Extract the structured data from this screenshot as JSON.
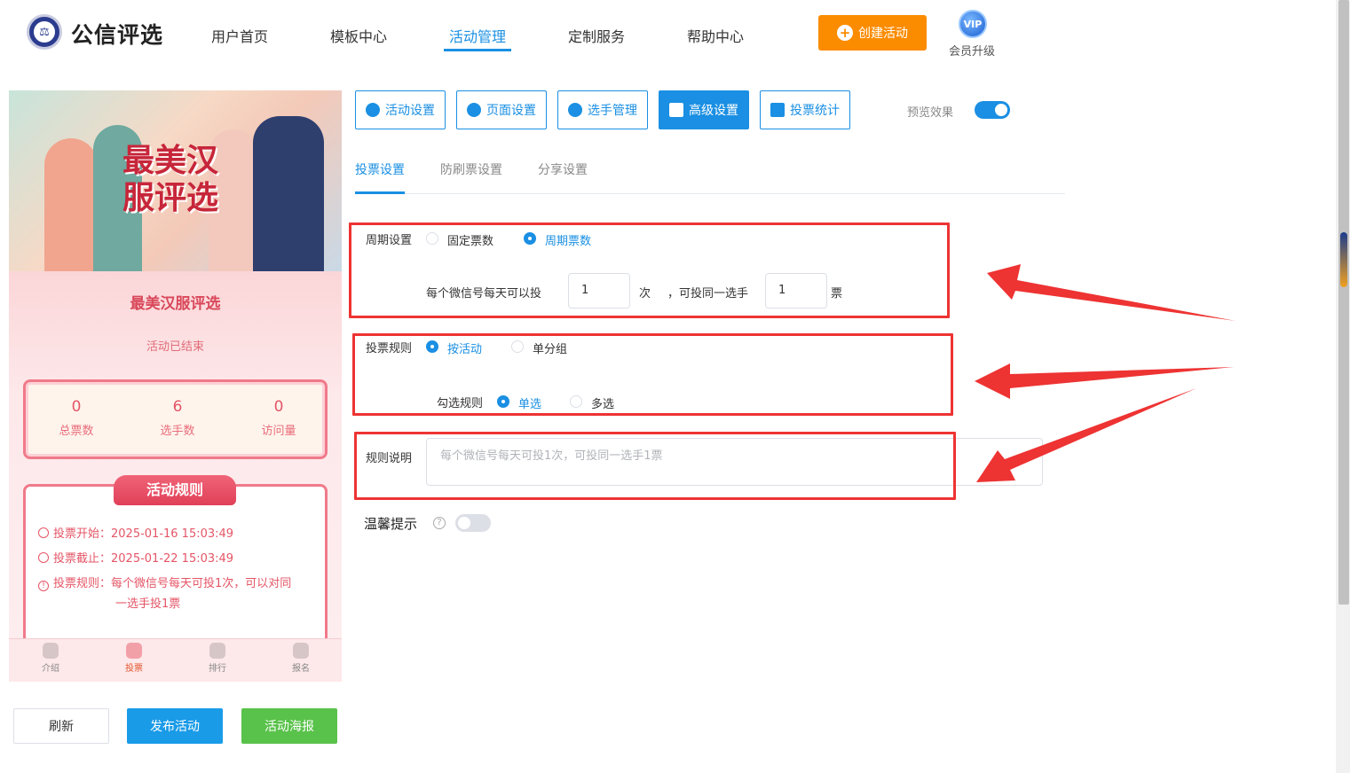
{
  "header": {
    "brand": "公信评选",
    "logo_text": "⚖",
    "nav": [
      "用户首页",
      "模板中心",
      "活动管理",
      "定制服务",
      "帮助中心"
    ],
    "active_nav": "活动管理",
    "create_button": "创建活动",
    "vip_badge": "VIP",
    "vip_label": "会员升级"
  },
  "preview": {
    "banner_title": "最美汉服评选",
    "title": "最美汉服评选",
    "status": "活动已结束",
    "stats": [
      {
        "value": "0",
        "label": "总票数"
      },
      {
        "value": "6",
        "label": "选手数"
      },
      {
        "value": "0",
        "label": "访问量"
      }
    ],
    "rules_title": "活动规则",
    "rule_start": "投票开始：2025-01-16 15:03:49",
    "rule_end": "投票截止：2025-01-22 15:03:49",
    "rule_text_1": "投票规则：每个微信号每天可投1次，可以对同",
    "rule_text_2": "一选手投1票",
    "tabbar": [
      "介绍",
      "投票",
      "排行",
      "报名"
    ],
    "active_tab": "投票"
  },
  "actions": {
    "refresh": "刷新",
    "publish": "发布活动",
    "poster": "活动海报"
  },
  "settings_tabs": [
    "活动设置",
    "页面设置",
    "选手管理",
    "高级设置",
    "投票统计"
  ],
  "active_settings_tab": "高级设置",
  "preview_toggle_label": "预览效果",
  "preview_toggle_on": true,
  "sub_tabs": [
    "投票设置",
    "防刷票设置",
    "分享设置"
  ],
  "active_sub_tab": "投票设置",
  "form": {
    "period_label": "周期设置",
    "period_options": [
      "固定票数",
      "周期票数"
    ],
    "period_selected": "周期票数",
    "per_day_prefix": "每个微信号每天可以投",
    "per_day_value": "1",
    "per_day_unit": "次",
    "same_player_prefix": "，可投同一选手",
    "same_player_value": "1",
    "same_player_unit": "票",
    "vote_rule_label": "投票规则",
    "vote_rule_options": [
      "按活动",
      "单分组"
    ],
    "vote_rule_selected": "按活动",
    "check_rule_label": "勾选规则",
    "check_rule_options": [
      "单选",
      "多选"
    ],
    "check_rule_selected": "单选",
    "rule_desc_label": "规则说明",
    "rule_desc_placeholder": "每个微信号每天可投1次，可投同一选手1票",
    "warm_tip_label": "温馨提示",
    "warm_tip_on": false
  },
  "colors": {
    "primary": "#1a8fe3",
    "orange": "#fb8c00",
    "green": "#59c24a",
    "annotation_red": "#ee3333",
    "preview_pink": "#e45566"
  }
}
